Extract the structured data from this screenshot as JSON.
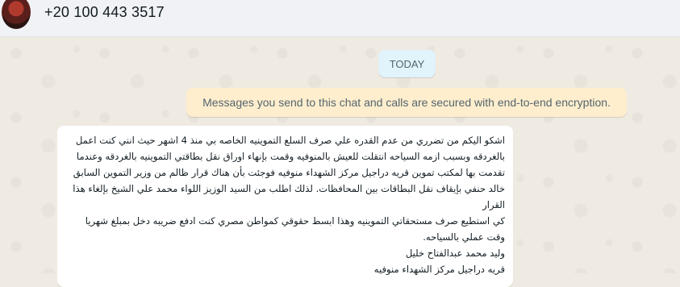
{
  "header": {
    "contact_name": "+20 100 443 3517"
  },
  "chat": {
    "date_chip": "TODAY",
    "encryption_notice": "Messages you send to this chat and calls are secured with end-to-end encryption.",
    "message": {
      "lines": [
        "اشكو اليكم من تضرري من عدم القدره علي صرف السلع التموينيه الخاصه بي منذ 4 اشهر حيث انني كنت اعمل",
        "بالغردقه وبسبب ازمه السياحه انتقلت للعيش بالمنوفيه وقمت بإنهاء اوراق نقل بطاقتي التموينيه بالغردقه وعندما",
        "تقدمت بها لمكتب تموين قريه دراجيل مركز الشهداء منوفيه فوجئت بأن هناك قرار ظالم من وزير التموين السابق",
        "خالد حنفي بإيقاف نقل البطاقات بين المحافظات. لذلك اطلب من السيد الوزيز اللواء محمد علي الشيخ بإلغاء هذا القرار",
        "كي استطيع صرف مستحقاتي التموينيه وهذا ابسط حقوقي كمواطن مصري كنت ادفع ضريبه دخل بمبلغ شهريا",
        "وقت عملي بالسياحه.",
        "وليد محمد عبدالفتاح خليل",
        "قريه دراجيل مركز الشهداء منوفيه"
      ]
    }
  }
}
